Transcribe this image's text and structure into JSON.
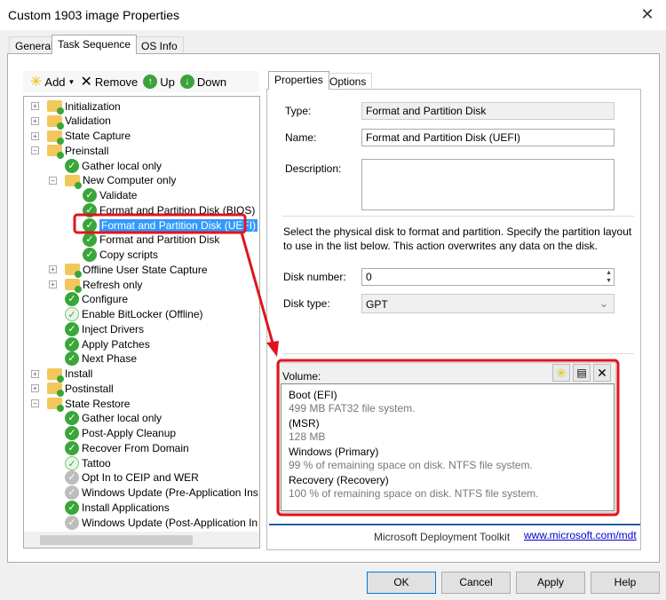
{
  "window": {
    "title": "Custom 1903 image Properties",
    "close": "✕"
  },
  "tabs": [
    "General",
    "Task Sequence",
    "OS Info"
  ],
  "toolbar": {
    "add": "Add",
    "remove": "Remove",
    "up": "Up",
    "down": "Down"
  },
  "tree": [
    {
      "label": "Initialization",
      "level": 0,
      "icon": "folder",
      "toggle": "+"
    },
    {
      "label": "Validation",
      "level": 0,
      "icon": "folder",
      "toggle": "+"
    },
    {
      "label": "State Capture",
      "level": 0,
      "icon": "folder",
      "toggle": "+"
    },
    {
      "label": "Preinstall",
      "level": 0,
      "icon": "folder",
      "toggle": "-"
    },
    {
      "label": "Gather local only",
      "level": 1,
      "icon": "check"
    },
    {
      "label": "New Computer only",
      "level": 1,
      "icon": "folder",
      "toggle": "-"
    },
    {
      "label": "Validate",
      "level": 2,
      "icon": "check"
    },
    {
      "label": "Format and Partition Disk (BIOS)",
      "level": 2,
      "icon": "check"
    },
    {
      "label": "Format and Partition Disk (UEFI)",
      "level": 2,
      "icon": "check",
      "selected": true
    },
    {
      "label": "Format and Partition Disk",
      "level": 2,
      "icon": "check"
    },
    {
      "label": "Copy scripts",
      "level": 2,
      "icon": "check"
    },
    {
      "label": "Offline User State Capture",
      "level": 1,
      "icon": "folder",
      "toggle": "+"
    },
    {
      "label": "Refresh only",
      "level": 1,
      "icon": "folder",
      "toggle": "+"
    },
    {
      "label": "Configure",
      "level": 1,
      "icon": "check"
    },
    {
      "label": "Enable BitLocker (Offline)",
      "level": 1,
      "icon": "checklight"
    },
    {
      "label": "Inject Drivers",
      "level": 1,
      "icon": "check"
    },
    {
      "label": "Apply Patches",
      "level": 1,
      "icon": "check"
    },
    {
      "label": "Next Phase",
      "level": 1,
      "icon": "check"
    },
    {
      "label": "Install",
      "level": 0,
      "icon": "folder",
      "toggle": "+"
    },
    {
      "label": "Postinstall",
      "level": 0,
      "icon": "folder",
      "toggle": "+"
    },
    {
      "label": "State Restore",
      "level": 0,
      "icon": "folder",
      "toggle": "-"
    },
    {
      "label": "Gather local only",
      "level": 1,
      "icon": "check"
    },
    {
      "label": "Post-Apply Cleanup",
      "level": 1,
      "icon": "check"
    },
    {
      "label": "Recover From Domain",
      "level": 1,
      "icon": "check"
    },
    {
      "label": "Tattoo",
      "level": 1,
      "icon": "checklight"
    },
    {
      "label": "Opt In to CEIP and WER",
      "level": 1,
      "icon": "grey"
    },
    {
      "label": "Windows Update (Pre-Application Ins",
      "level": 1,
      "icon": "grey"
    },
    {
      "label": "Install Applications",
      "level": 1,
      "icon": "check"
    },
    {
      "label": "Windows Update (Post-Application In",
      "level": 1,
      "icon": "grey"
    }
  ],
  "right_tabs": [
    "Properties",
    "Options"
  ],
  "props": {
    "type_label": "Type:",
    "type_value": "Format and Partition Disk",
    "name_label": "Name:",
    "name_value": "Format and Partition Disk (UEFI)",
    "desc_label": "Description:",
    "desc_value": "",
    "instructions": "Select the physical disk to format and partition.  Specify the partition layout to use in the list below.  This action overwrites any data on the disk.",
    "disk_number_label": "Disk number:",
    "disk_number": "0",
    "disk_type_label": "Disk type:",
    "disk_type": "GPT",
    "volume_label": "Volume:",
    "volumes": [
      {
        "name": "Boot (EFI)",
        "desc": "499 MB FAT32 file system."
      },
      {
        "name": " (MSR)",
        "desc": "128 MB"
      },
      {
        "name": "Windows (Primary)",
        "desc": "99 % of remaining space on disk. NTFS file system."
      },
      {
        "name": "Recovery (Recovery)",
        "desc": "100 % of remaining space on disk. NTFS file system."
      }
    ]
  },
  "footer": {
    "brand": "Microsoft Deployment Toolkit",
    "link": "www.microsoft.com/mdt"
  },
  "buttons": {
    "ok": "OK",
    "cancel": "Cancel",
    "apply": "Apply",
    "help": "Help"
  },
  "colors": {
    "annotation": "#e0141e",
    "selection": "#3399ff",
    "footer_line": "#1f5f9f"
  }
}
